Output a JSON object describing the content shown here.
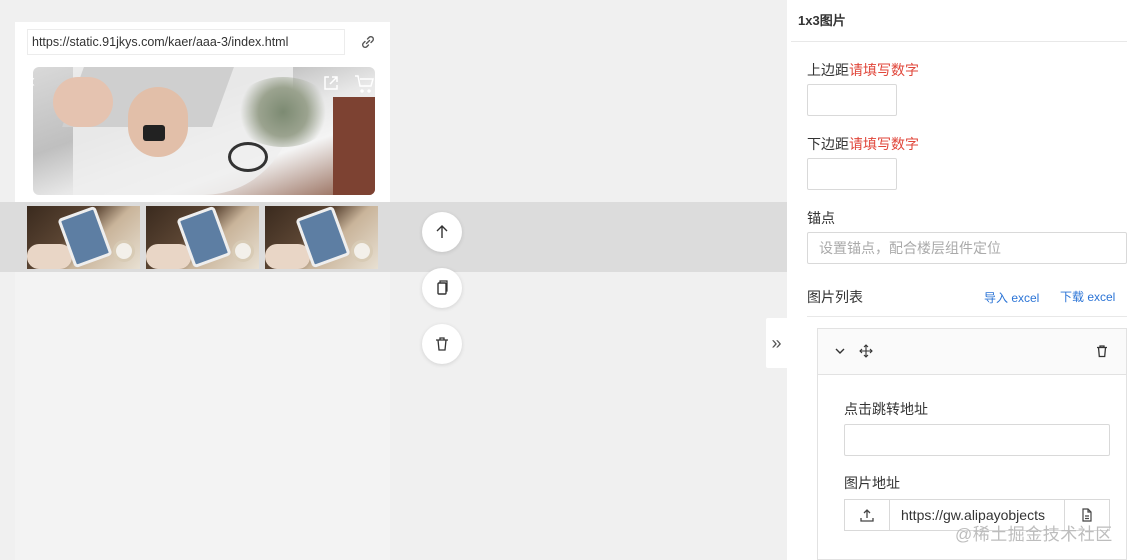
{
  "preview": {
    "url": "https://static.91jkys.com/kaer/aaa-3/index.html",
    "hero_icons": [
      "chevron-left-icon",
      "share-icon",
      "cart-icon"
    ],
    "thumbnails": [
      "thumb-1",
      "thumb-2",
      "thumb-3"
    ]
  },
  "panel": {
    "title": "1x3图片",
    "top_margin": {
      "label": "上边距",
      "hint": "请填写数字",
      "value": ""
    },
    "bottom_margin": {
      "label": "下边距",
      "hint": "请填写数字",
      "value": ""
    },
    "anchor": {
      "label": "锚点",
      "placeholder": "设置锚点，配合楼层组件定位"
    },
    "image_list": {
      "label": "图片列表",
      "import_label": "导入 excel",
      "download_label": "下载 excel",
      "items": [
        {
          "link_label": "点击跳转地址",
          "link_value": "",
          "image_label": "图片地址",
          "image_value": "https://gw.alipayobjects"
        }
      ]
    }
  },
  "toolbar": {
    "collapse_glyph": "»"
  },
  "watermark": "@稀土掘金技术社区",
  "colors": {
    "hint": "#e0463a",
    "link": "#2b74d6",
    "panel_bg": "#ffffff",
    "canvas_bg": "#f0f0f0"
  }
}
